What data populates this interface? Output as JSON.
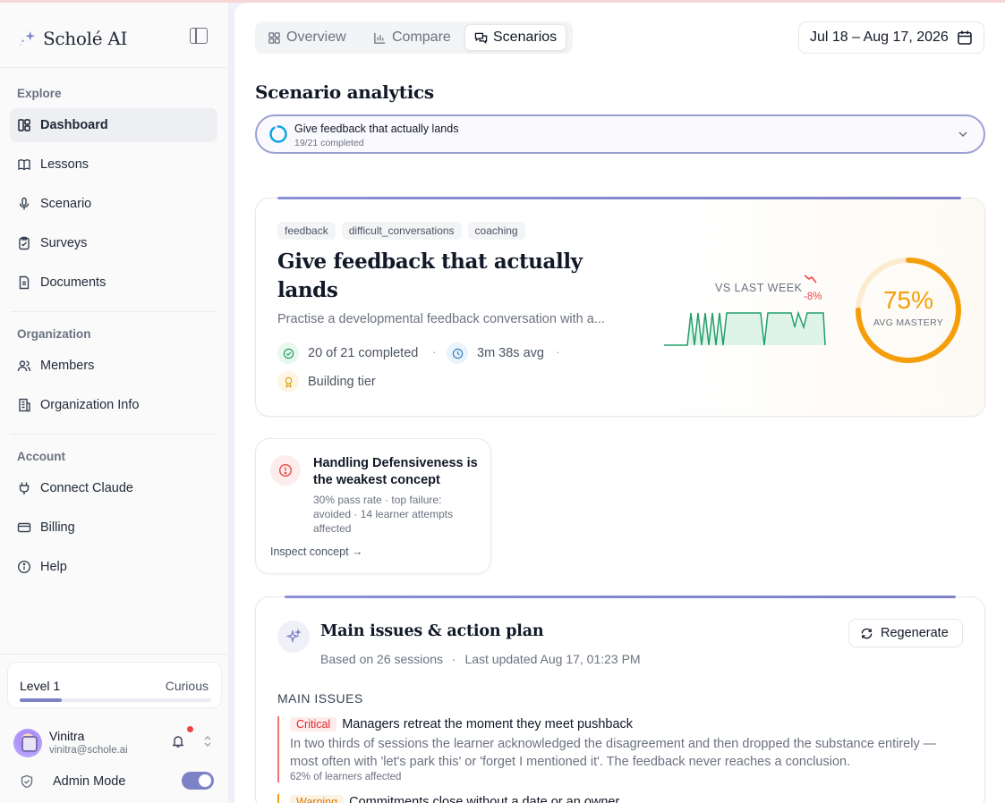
{
  "app": {
    "name": "Scholé AI"
  },
  "sidebar": {
    "sections": [
      {
        "title": "Explore",
        "items": [
          {
            "label": "Dashboard",
            "icon": "dashboard-icon",
            "active": true
          },
          {
            "label": "Lessons",
            "icon": "book-icon"
          },
          {
            "label": "Scenario",
            "icon": "mic-icon"
          },
          {
            "label": "Surveys",
            "icon": "clipboard-icon"
          },
          {
            "label": "Documents",
            "icon": "document-icon"
          }
        ]
      },
      {
        "title": "Organization",
        "items": [
          {
            "label": "Members",
            "icon": "users-icon"
          },
          {
            "label": "Organization Info",
            "icon": "building-icon"
          }
        ]
      },
      {
        "title": "Account",
        "items": [
          {
            "label": "Connect Claude",
            "icon": "plug-icon"
          },
          {
            "label": "Billing",
            "icon": "card-icon"
          },
          {
            "label": "Help",
            "icon": "info-icon"
          }
        ]
      }
    ],
    "level": {
      "label": "Level 1",
      "tier": "Curious",
      "progress": 0.22
    },
    "user": {
      "name": "Vinitra",
      "email": "vinitra@schole.ai"
    },
    "admin": {
      "label": "Admin Mode",
      "enabled": true
    }
  },
  "header": {
    "tabs": [
      {
        "label": "Overview",
        "icon": "grid-icon"
      },
      {
        "label": "Compare",
        "icon": "bar-chart-icon"
      },
      {
        "label": "Scenarios",
        "icon": "chat-icon",
        "active": true
      }
    ],
    "date_range": "Jul 18 – Aug 17, 2026"
  },
  "page": {
    "title": "Scenario analytics",
    "selector": {
      "title": "Give feedback that actually lands",
      "subtitle": "19/21 completed",
      "progress": 0.9
    }
  },
  "hero": {
    "tags": [
      "feedback",
      "difficult_conversations",
      "coaching"
    ],
    "title": "Give feedback that actually lands",
    "description": "Practise a developmental feedback conversation with a...",
    "completed": "20 of 21 completed",
    "avg_time": "3m 38s avg",
    "tier": "Building tier",
    "vs_label": "VS LAST WEEK",
    "trend": "-8%",
    "mastery_value": "75%",
    "mastery_label": "AVG MASTERY",
    "mastery_fraction": 0.75,
    "colors": {
      "accent": "#7d82c6",
      "gauge": "#f59e0b",
      "spark": "#22a06b",
      "negative": "#ef4444"
    }
  },
  "concept": {
    "title": "Handling Defensiveness is the weakest concept",
    "subtitle": "30% pass rate · top failure: avoided · 14 learner attempts affected",
    "link": "Inspect concept →"
  },
  "plan": {
    "title": "Main issues & action plan",
    "sessions": "Based on 26 sessions",
    "updated": "Last updated Aug 17, 01:23 PM",
    "regenerate": "Regenerate",
    "section_title": "MAIN ISSUES",
    "issues": [
      {
        "severity": "Critical",
        "title": "Managers retreat the moment they meet pushback",
        "body": "In two thirds of sessions the learner acknowledged the disagreement and then dropped the substance entirely — most often with 'let's park this' or 'forget I mentioned it'. The feedback never reaches a conclusion.",
        "foot": "62% of learners affected"
      },
      {
        "severity": "Warning",
        "title": "Commitments close without a date or an owner",
        "body": "",
        "foot": ""
      }
    ]
  }
}
